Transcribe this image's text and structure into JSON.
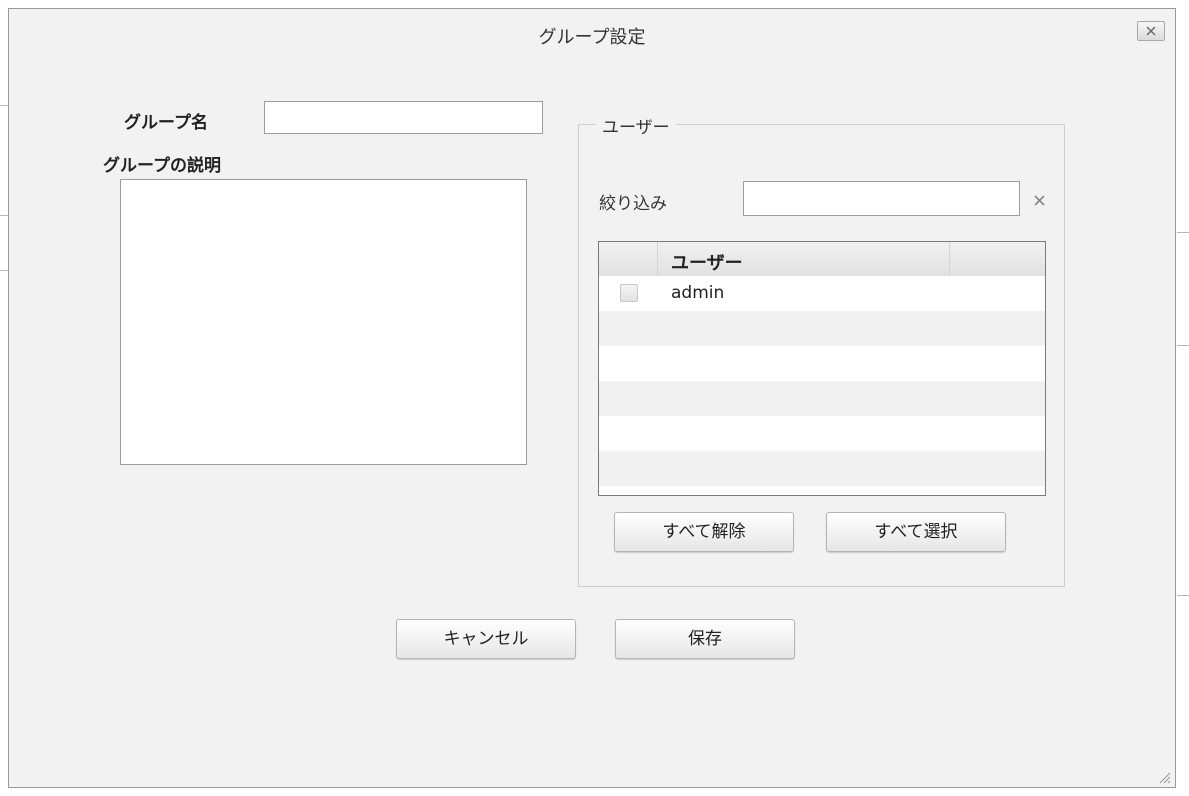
{
  "dialog": {
    "title": "グループ設定"
  },
  "group": {
    "name_label": "グループ名",
    "name_value": "",
    "description_label": "グループの説明",
    "description_value": ""
  },
  "users_panel": {
    "legend": "ユーザー",
    "filter_label": "絞り込み",
    "filter_value": "",
    "table": {
      "column_header": "ユーザー",
      "rows": [
        {
          "name": "admin",
          "checked": false
        }
      ]
    },
    "deselect_all_label": "すべて解除",
    "select_all_label": "すべて選択"
  },
  "footer": {
    "cancel_label": "キャンセル",
    "save_label": "保存"
  }
}
